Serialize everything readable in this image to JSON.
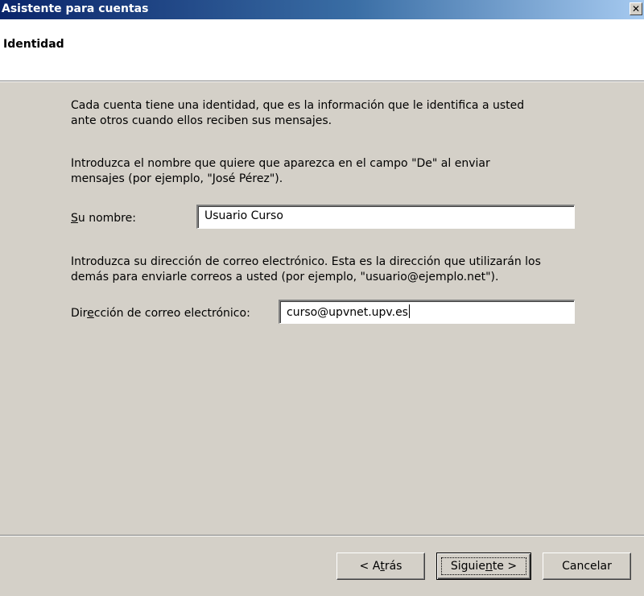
{
  "window": {
    "title": "Asistente para cuentas",
    "close_glyph": "✕"
  },
  "header": {
    "page_title": "Identidad"
  },
  "content": {
    "intro_line1": "Cada cuenta tiene una identidad, que es la información que le identifica a usted",
    "intro_line2": "ante otros cuando ellos reciben sus mensajes.",
    "name_prompt_line1": "Introduzca el nombre que quiere que aparezca en el campo \"De\" al enviar",
    "name_prompt_line2": "mensajes (por ejemplo, \"José Pérez\").",
    "name_label_accel": "S",
    "name_label_rest": "u nombre:",
    "name_value": "Usuario Curso",
    "email_prompt_line1": "Introduzca su dirección de correo electrónico. Esta es la dirección que utilizarán los",
    "email_prompt_line2": "demás para enviarle correos a usted (por ejemplo, \"usuario@ejemplo.net\").",
    "email_label_pre": "Dir",
    "email_label_accel": "e",
    "email_label_post": "cción de correo electrónico:",
    "email_value": "curso@upvnet.upv.es"
  },
  "buttons": {
    "back_pre": "< A",
    "back_accel": "t",
    "back_post": "rás",
    "next_pre": "Siguie",
    "next_accel": "n",
    "next_post": "te >",
    "cancel": "Cancelar"
  },
  "colors": {
    "titlebar_start": "#0a246a",
    "titlebar_end": "#a6caf0",
    "dialog_background": "#d4d0c8",
    "header_background": "#ffffff"
  },
  "icons": {
    "close": "close-icon"
  }
}
